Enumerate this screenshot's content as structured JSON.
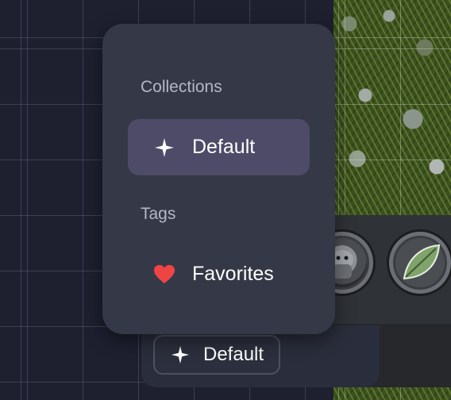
{
  "menu": {
    "collections_title": "Collections",
    "tags_title": "Tags",
    "items": [
      {
        "label": "Default",
        "icon": "sparkle-icon",
        "selected": true
      },
      {
        "label": "Favorites",
        "icon": "heart-icon",
        "selected": false
      }
    ]
  },
  "footer": {
    "chip_label": "Default",
    "chip_icon": "sparkle-icon"
  },
  "colors": {
    "menu_bg": "#353846",
    "selected_item_bg": "#4e4b69",
    "heart": "#ef4444",
    "background": "#1e2030"
  }
}
